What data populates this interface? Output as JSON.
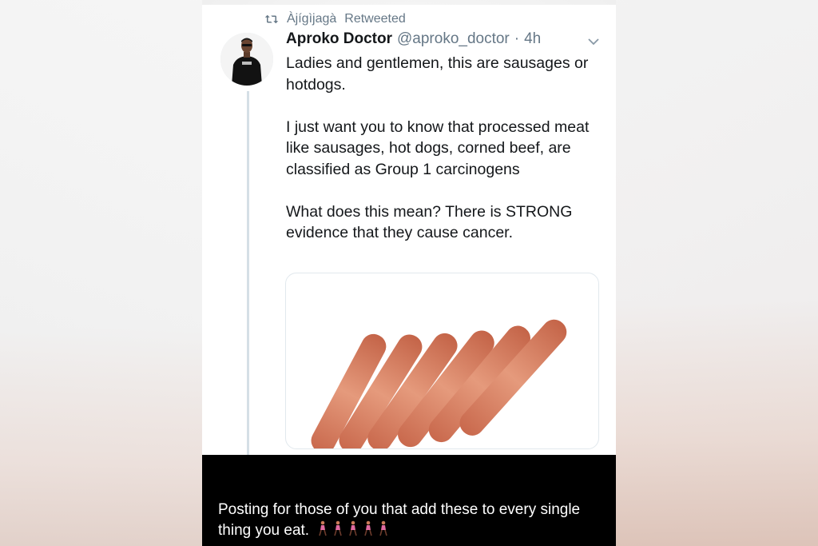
{
  "retweet": {
    "icon": "retweet-icon",
    "by": "Àjígìjagà",
    "label": "Retweeted"
  },
  "tweet": {
    "author": {
      "name": "Aproko Doctor",
      "handle": "@aproko_doctor",
      "separator": "·",
      "time": "4h",
      "avatar": "profile-avatar"
    },
    "menu_icon": "chevron-down-icon",
    "paragraphs": [
      "Ladies and gentlemen, this are sausages or hotdogs.",
      "I just want you to know that processed meat like sausages, hot dogs, corned beef, are classified as Group 1 carcinogens",
      "What does this mean? There is STRONG evidence that they cause cancer."
    ],
    "media": "sausages-photo"
  },
  "caption": {
    "text": "Posting for those of you that add these to every single thing you eat.",
    "emoji": "woman-walking-icon",
    "emoji_count": 5
  },
  "colors": {
    "name": "#14171a",
    "muted": "#657786",
    "thread": "#d5dfe6",
    "caption_bg": "#000000",
    "sausage": "#d9876a"
  }
}
